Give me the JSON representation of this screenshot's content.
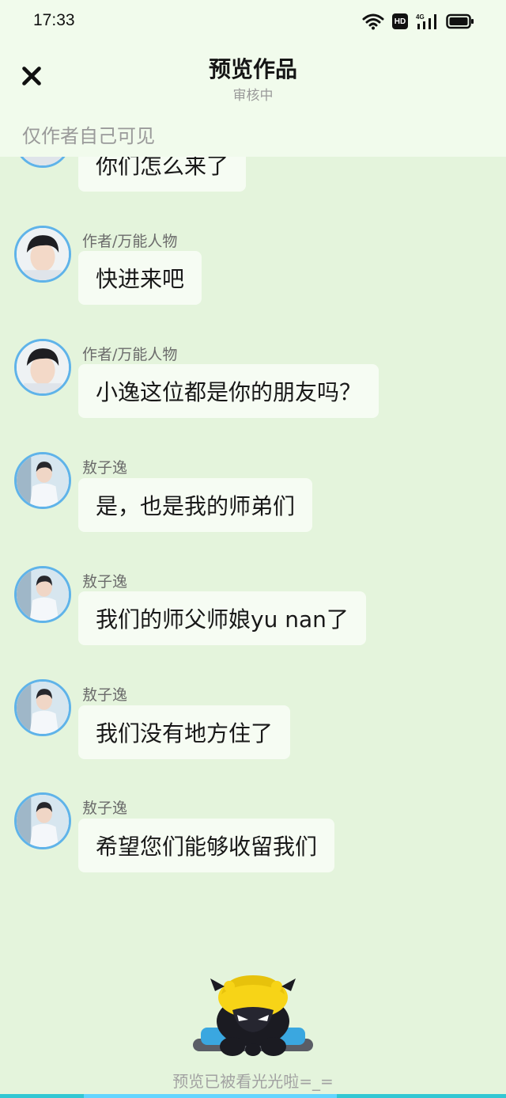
{
  "status_bar": {
    "time": "17:33",
    "icons": [
      "wifi-icon",
      "hd-icon",
      "signal-4g-icon",
      "battery-icon"
    ],
    "hd_label": "HD",
    "network_label": "4G"
  },
  "header": {
    "title": "预览作品",
    "status": "审核中",
    "close_icon": "close-icon",
    "visibility_note": "仅作者自己可见"
  },
  "messages": [
    {
      "sender": "",
      "text": "你们怎么来了",
      "avatar": "author-avatar"
    },
    {
      "sender": "作者/万能人物",
      "text": "快进来吧",
      "avatar": "author-avatar"
    },
    {
      "sender": "作者/万能人物",
      "text": "小逸这位都是你的朋友吗？",
      "avatar": "author-avatar"
    },
    {
      "sender": "敖子逸",
      "text": "是，也是我的师弟们",
      "avatar": "character-avatar"
    },
    {
      "sender": "敖子逸",
      "text": "我们的师父师娘yu nan了",
      "avatar": "character-avatar"
    },
    {
      "sender": "敖子逸",
      "text": "我们没有地方住了",
      "avatar": "character-avatar"
    },
    {
      "sender": "敖子逸",
      "text": "希望您们能够收留我们",
      "avatar": "character-avatar"
    }
  ],
  "footer": {
    "mascot_icon": "mascot-icon",
    "text": "预览已被看光光啦=_="
  },
  "colors": {
    "background": "#e4f4dc",
    "header": "#f1fbec",
    "bubble": "#f6fcf3",
    "avatar_border": "#5fb3e9",
    "bottom_bar": "#32c7d3"
  }
}
